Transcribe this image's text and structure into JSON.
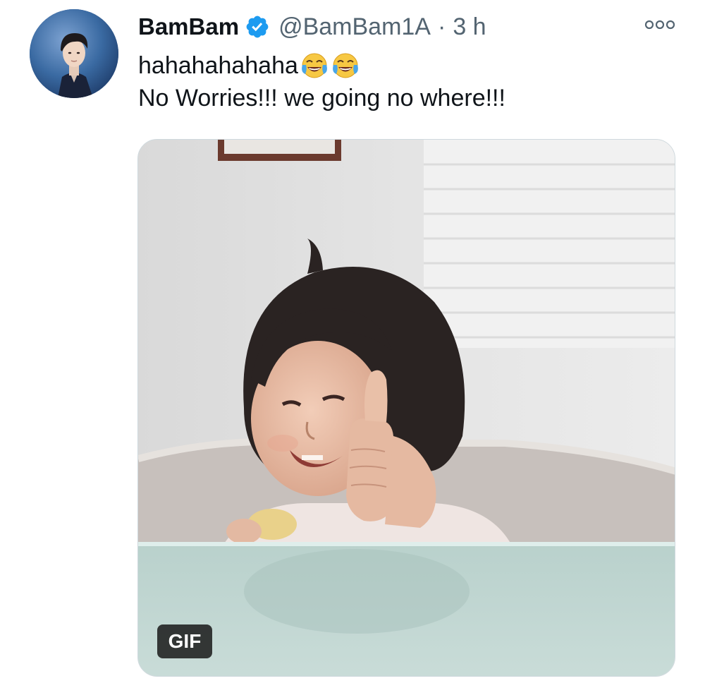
{
  "tweet": {
    "author": {
      "display_name": "BamBam",
      "handle": "@BamBam1A",
      "verified": true,
      "avatar_icon": "avatar-photo"
    },
    "separator": "·",
    "time": "3 h",
    "more_icon": "more-dots-icon",
    "text_lines": [
      {
        "text": "hahahahahaha",
        "emojis": [
          "face-with-tears-of-joy",
          "face-with-tears-of-joy"
        ]
      },
      {
        "text": "No Worries!!! we going no where!!!"
      }
    ],
    "media": {
      "type": "gif",
      "badge_label": "GIF",
      "description_icon": "gif-thumbnail"
    }
  },
  "colors": {
    "text_primary": "#0f1419",
    "text_secondary": "#536471",
    "verified_blue": "#1d9bf0",
    "border": "#cfd9de"
  }
}
